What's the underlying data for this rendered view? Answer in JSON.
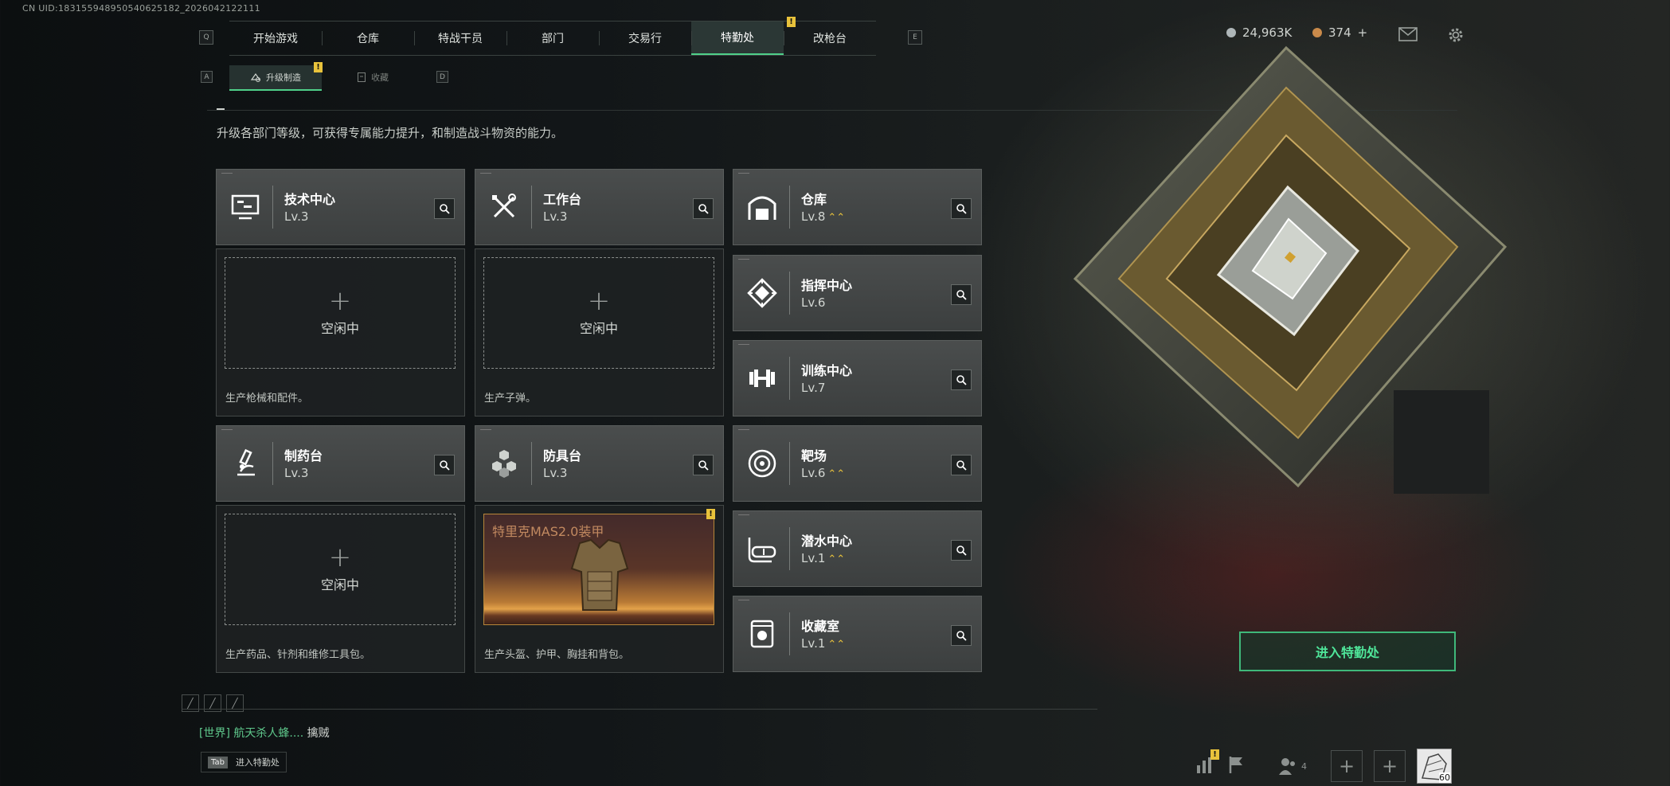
{
  "uid_text": "CN UID:183155948950540625182_2026042122111",
  "nav": {
    "left_key": "Q",
    "right_key": "E",
    "tabs": [
      {
        "label": "开始游戏"
      },
      {
        "label": "仓库"
      },
      {
        "label": "特战干员"
      },
      {
        "label": "部门"
      },
      {
        "label": "交易行"
      },
      {
        "label": "特勤处",
        "active": true,
        "alert": "!"
      },
      {
        "label": "改枪台"
      }
    ]
  },
  "subnav": {
    "left_key": "A",
    "right_key": "D",
    "upgrade_label": "升级制造",
    "upgrade_alert": "!",
    "collect_label": "收藏"
  },
  "currency": {
    "coins": "24,963K",
    "tickets": "374",
    "add": "+"
  },
  "intro": "升级各部门等级，可获得专属能力提升，和制造战斗物资的能力。",
  "facilities": {
    "tech": {
      "title": "技术中心",
      "level": "Lv.3",
      "idle": "空闲中",
      "plus": "+",
      "desc": "生产枪械和配件。"
    },
    "workbench": {
      "title": "工作台",
      "level": "Lv.3",
      "idle": "空闲中",
      "plus": "+",
      "desc": "生产子弹。"
    },
    "pharmacy": {
      "title": "制药台",
      "level": "Lv.3",
      "idle": "空闲中",
      "plus": "+",
      "desc": "生产药品、针剂和维修工具包。"
    },
    "armory": {
      "title": "防具台",
      "level": "Lv.3",
      "producing": "特里克MAS2.0装甲",
      "alert": "!",
      "desc": "生产头盔、护甲、胸挂和背包。"
    }
  },
  "side_facilities": [
    {
      "title": "仓库",
      "level": "Lv.8",
      "upgradable": true
    },
    {
      "title": "指挥中心",
      "level": "Lv.6",
      "upgradable": false
    },
    {
      "title": "训练中心",
      "level": "Lv.7",
      "upgradable": false
    },
    {
      "title": "靶场",
      "level": "Lv.6",
      "upgradable": true
    },
    {
      "title": "潜水中心",
      "level": "Lv.1",
      "upgradable": true
    },
    {
      "title": "收藏室",
      "level": "Lv.1",
      "upgradable": true
    }
  ],
  "enter_button": "进入特勤处",
  "chat": {
    "channel": "[世界]",
    "name": "航天杀人蜂....",
    "message": "擒贼"
  },
  "tab_hint": {
    "key": "Tab",
    "label": "进入特勤处"
  },
  "bottom": {
    "squad_count": "4",
    "alert": "!",
    "avatar_level": "60"
  },
  "colors": {
    "accent": "#4fd089",
    "alert": "#e8c23b",
    "upgrade_arrow": "#e8c23b"
  }
}
